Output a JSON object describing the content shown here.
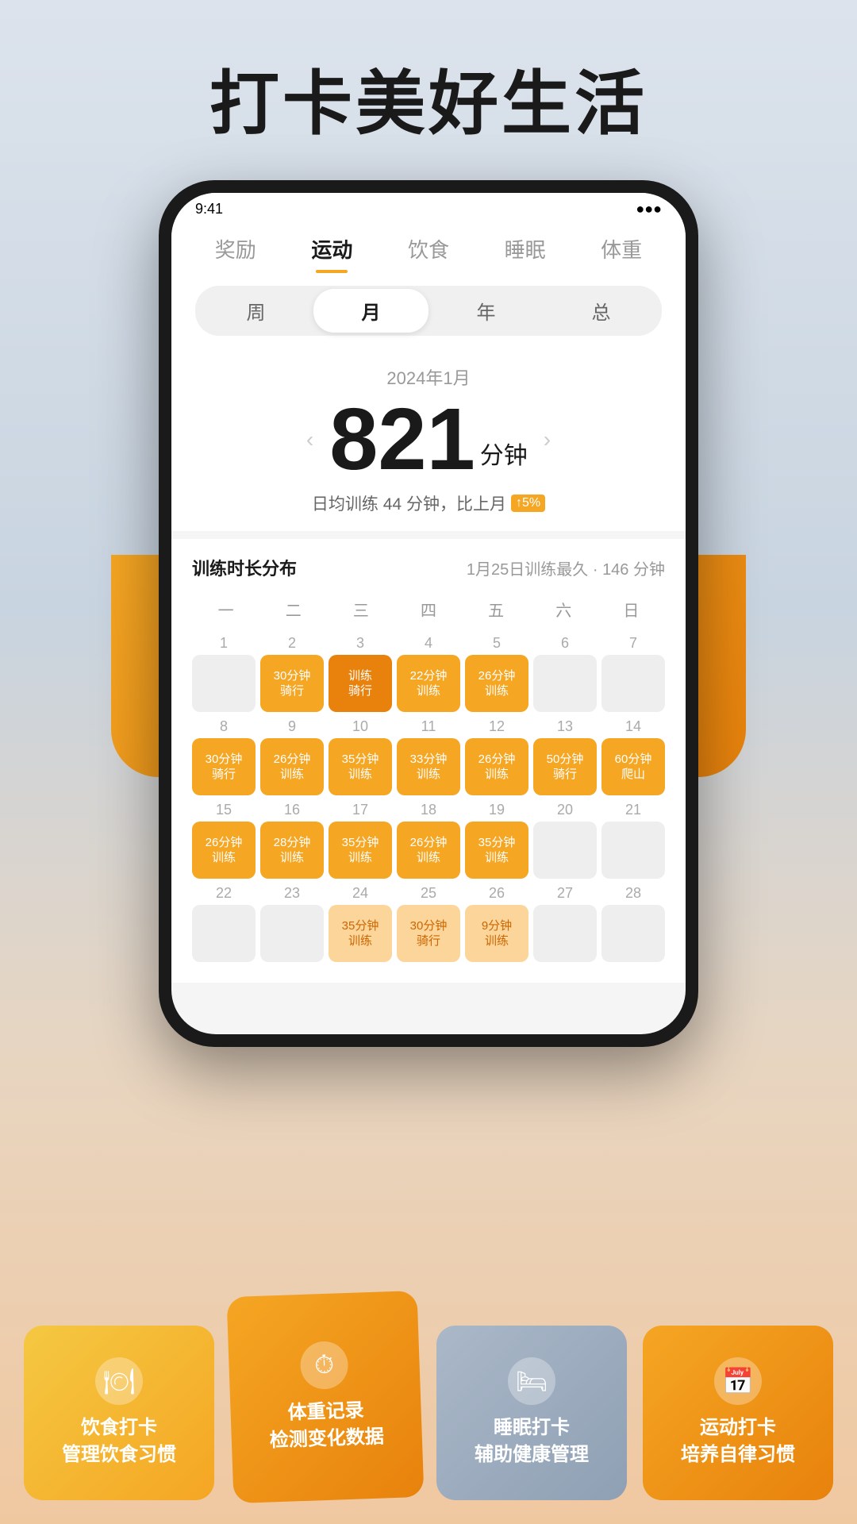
{
  "page": {
    "title": "打卡美好生活"
  },
  "nav": {
    "tabs": [
      "奖励",
      "运动",
      "饮食",
      "睡眠",
      "体重"
    ],
    "active": "运动"
  },
  "period": {
    "options": [
      "周",
      "月",
      "年",
      "总"
    ],
    "active": "月"
  },
  "stats": {
    "date": "2024年1月",
    "value": "821",
    "unit": "分钟",
    "sub": "日均训练 44 分钟，比上月",
    "trend": "↑5%"
  },
  "calendar": {
    "title": "训练时长分布",
    "subtitle": "1月25日训练最久 · 146 分钟",
    "weekdays": [
      "一",
      "二",
      "三",
      "四",
      "五",
      "六",
      "日"
    ],
    "weeks": [
      {
        "dates": [
          "1",
          "2",
          "3",
          "4",
          "5",
          "6",
          "7"
        ],
        "cells": [
          {
            "type": "empty"
          },
          {
            "type": "active",
            "label": "30分钟\n骑行"
          },
          {
            "type": "active-dark",
            "label": "训练\n骑行"
          },
          {
            "type": "active",
            "label": "22分钟\n训练"
          },
          {
            "type": "active",
            "label": "26分钟\n训练"
          },
          {
            "type": "empty"
          },
          {
            "type": "empty"
          }
        ]
      },
      {
        "dates": [
          "8",
          "9",
          "10",
          "11",
          "12",
          "13",
          "14"
        ],
        "cells": [
          {
            "type": "active",
            "label": "30分钟\n骑行"
          },
          {
            "type": "active",
            "label": "26分钟\n训练"
          },
          {
            "type": "active",
            "label": "35分钟\n训练"
          },
          {
            "type": "active",
            "label": "33分钟\n训练"
          },
          {
            "type": "active",
            "label": "26分钟\n训练"
          },
          {
            "type": "active",
            "label": "50分钟\n骑行"
          },
          {
            "type": "active",
            "label": "60分钟\n爬山"
          }
        ]
      },
      {
        "dates": [
          "15",
          "16",
          "17",
          "18",
          "19",
          "20",
          "21"
        ],
        "cells": [
          {
            "type": "active",
            "label": "26分钟\n训练"
          },
          {
            "type": "active",
            "label": "28分钟\n训练"
          },
          {
            "type": "active",
            "label": "35分钟\n训练"
          },
          {
            "type": "active",
            "label": "26分钟\n训练"
          },
          {
            "type": "active",
            "label": "35分钟\n训练"
          },
          {
            "type": "empty"
          },
          {
            "type": "empty"
          }
        ]
      },
      {
        "dates": [
          "22",
          "23",
          "24",
          "25",
          "26",
          "27",
          "28"
        ],
        "cells": [
          {
            "type": "empty"
          },
          {
            "type": "empty"
          },
          {
            "type": "light",
            "label": "35分钟\n训练"
          },
          {
            "type": "light",
            "label": "30分钟\n骑行"
          },
          {
            "type": "light",
            "label": "9分钟\n训练"
          },
          {
            "type": "empty"
          },
          {
            "type": "empty"
          }
        ]
      }
    ]
  },
  "feature_cards": [
    {
      "id": "food",
      "icon": "🍽",
      "label": "饮食打卡\n管理饮食习惯",
      "color_start": "#f5c842",
      "color_end": "#f5a623"
    },
    {
      "id": "weight",
      "icon": "⏱",
      "label": "体重记录\n检测变化数据",
      "color_start": "#f5a623",
      "color_end": "#e8820c"
    },
    {
      "id": "sleep",
      "icon": "🛏",
      "label": "睡眠打卡\n辅助健康管理",
      "color_start": "#aab8c8",
      "color_end": "#8fa0b4"
    },
    {
      "id": "exercise",
      "icon": "📅",
      "label": "运动打卡\n培养自律习惯",
      "color_start": "#f5a623",
      "color_end": "#e8820c"
    }
  ]
}
